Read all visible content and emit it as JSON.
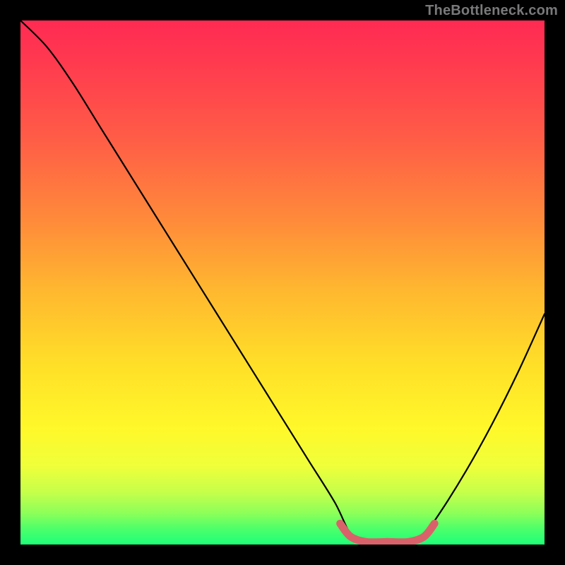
{
  "watermark": "TheBottleneck.com",
  "chart_data": {
    "type": "line",
    "title": "",
    "xlabel": "",
    "ylabel": "",
    "xlim": [
      0,
      100
    ],
    "ylim": [
      0,
      100
    ],
    "background_gradient": {
      "top": "#ff2a53",
      "bottom": "#1eff78",
      "meaning": "red=high bottleneck, green=low bottleneck"
    },
    "series": [
      {
        "name": "bottleneck-curve",
        "color": "#000000",
        "x": [
          0,
          5,
          10,
          15,
          20,
          25,
          30,
          35,
          40,
          45,
          50,
          55,
          60,
          63,
          66,
          74,
          77,
          80,
          85,
          90,
          95,
          100
        ],
        "values": [
          100,
          95,
          88,
          80,
          72,
          64,
          56,
          48,
          40,
          32,
          24,
          16,
          8,
          2,
          0,
          0,
          2,
          6,
          14,
          23,
          33,
          44
        ]
      },
      {
        "name": "optimal-range-highlight",
        "color": "#d9626a",
        "x": [
          61,
          63,
          66,
          70,
          74,
          77,
          79
        ],
        "values": [
          4,
          1.5,
          0.5,
          0.5,
          0.5,
          1.5,
          4
        ]
      }
    ],
    "optimal_range": {
      "x_start": 61,
      "x_end": 79
    }
  }
}
